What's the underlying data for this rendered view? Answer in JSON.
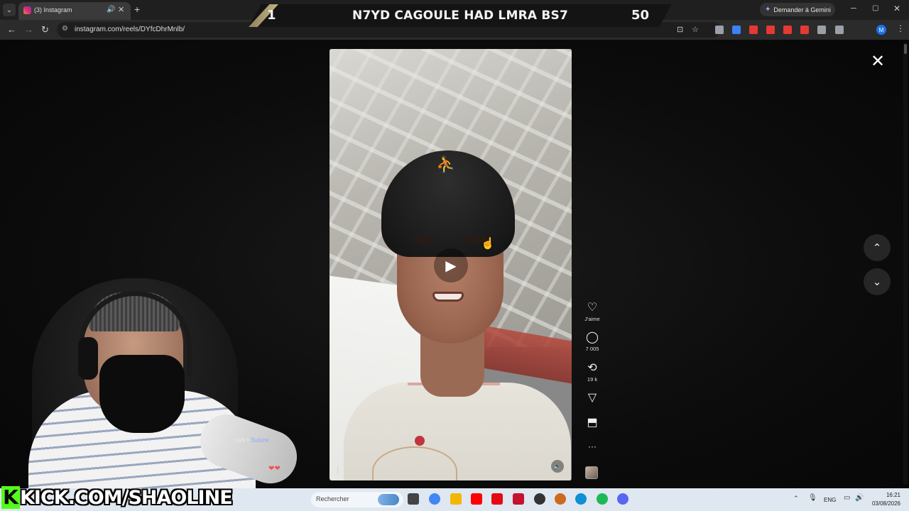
{
  "browser": {
    "tab_title": "(3) Instagram",
    "tab_close": "✕",
    "new_tab": "+",
    "url": "instagram.com/reels/DYfcDhrMnlb/",
    "gemini_label": "Demander à Gemini",
    "profile_initial": "M",
    "icons": {
      "back": "←",
      "forward": "→",
      "reload": "↻",
      "site_info": "⚙",
      "install": "⊡",
      "star": "☆",
      "menu": "⋮",
      "minimize": "─",
      "maximize": "▢",
      "close": "✕",
      "tab_list": "⌄",
      "audio": "🔊"
    },
    "extension_colors": [
      "#9aa0a6",
      "#3b82f6",
      "#e53935",
      "#e53935",
      "#e53935",
      "#e53935",
      "#9aa0a6",
      "#9aa0a6"
    ]
  },
  "stream_banner": {
    "left_number": "1",
    "text": "N7YD CAGOULE HAD LMRA BS7",
    "right_number": "50"
  },
  "reel": {
    "close": "✕",
    "prev": "⌃",
    "next": "⌄",
    "play": "▶",
    "mute": "🔈",
    "actions": {
      "like_label": "J'aime",
      "comments_count": "7 005",
      "reposts_count": "19 k"
    },
    "action_icons": {
      "like": "♡",
      "comment": "◯",
      "repost": "⟲",
      "share": "▽",
      "save": "⬒",
      "more": "···"
    },
    "overlay_user_suffix": "na9 •",
    "follow_label": "Suivre",
    "hearts": "❤❤"
  },
  "webcam": {
    "kick_logo": "K",
    "kick_text": "KICK.COM/SHAOLINE"
  },
  "taskbar": {
    "search_placeholder": "Rechercher",
    "tray": {
      "chevron": "⌃",
      "mic": "🎙",
      "language": "ENG",
      "network": "▭",
      "volume": "🔊"
    },
    "time": "16:21",
    "date": "03/08/2026",
    "app_colors": [
      "#444444",
      "#4285f4",
      "#f2b705",
      "#ff0000",
      "#e50914",
      "#c4122f",
      "#333333",
      "#cc6b1d",
      "#0f8fd6",
      "#1db954",
      "#5865f2"
    ]
  },
  "colors": {
    "kick_green": "#53fc18",
    "follow_blue": "#8ea9ff",
    "banner_gold": "#c9b98a"
  }
}
